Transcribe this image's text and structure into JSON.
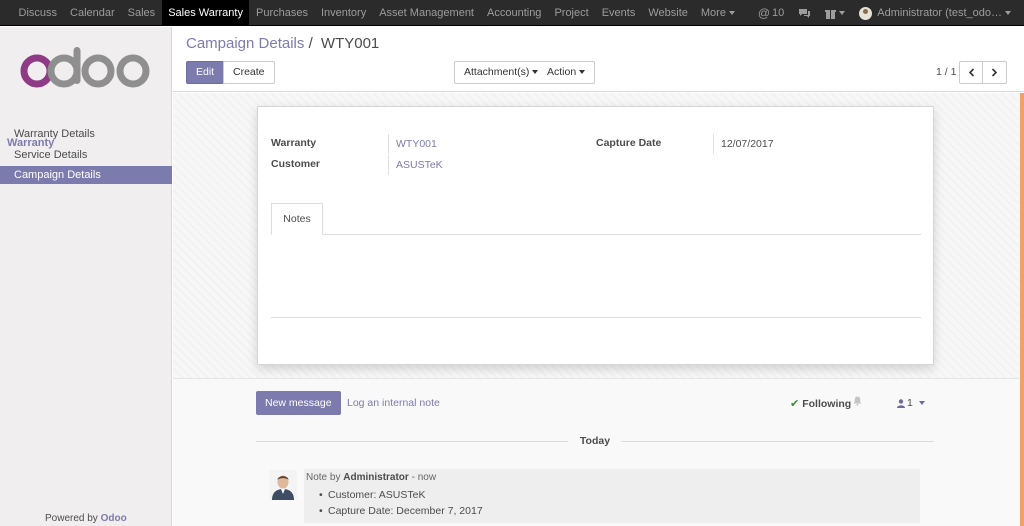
{
  "navbar": {
    "menus": [
      "Discuss",
      "Calendar",
      "Sales",
      "Sales Warranty",
      "Purchases",
      "Inventory",
      "Asset Management",
      "Accounting",
      "Project",
      "Events",
      "Website",
      "More"
    ],
    "active_menu": "Sales Warranty",
    "messages_count": "10",
    "user": "Administrator (test_odo…"
  },
  "sidebar": {
    "logo_text": "odoo",
    "section": "Warranty",
    "items": [
      "Warranty Details",
      "Service Details",
      "Campaign Details"
    ],
    "active_item": "Campaign Details",
    "powered_by_prefix": "Powered by",
    "powered_by_brand": "Odoo"
  },
  "control_panel": {
    "breadcrumb_parent": "Campaign Details",
    "breadcrumb_separator": "/",
    "breadcrumb_current": "WTY001",
    "edit_label": "Edit",
    "create_label": "Create",
    "attachments_label": "Attachment(s)",
    "action_label": "Action",
    "pager": "1 / 1"
  },
  "form": {
    "warranty_label": "Warranty",
    "warranty_value": "WTY001",
    "customer_label": "Customer",
    "customer_value": "ASUSTeK",
    "capture_date_label": "Capture Date",
    "capture_date_value": "12/07/2017",
    "tab_notes": "Notes"
  },
  "chatter": {
    "new_message_label": "New message",
    "log_note_label": "Log an internal note",
    "following_label": "Following",
    "followers_count": "1",
    "today_label": "Today",
    "message": {
      "prefix": "Note by",
      "author": "Administrator",
      "time": "- now",
      "lines": [
        "Customer: ASUSTeK",
        "Capture Date: December 7, 2017"
      ]
    }
  },
  "colors": {
    "brand": "#7c7bad",
    "navbar": "#2b2b2b",
    "accent_orange": "#f0a06a"
  },
  "icons": [
    "at-icon",
    "chat-icon",
    "gift-icon",
    "bell-icon",
    "user-icon",
    "check-icon",
    "chevron-left-icon",
    "chevron-right-icon"
  ]
}
